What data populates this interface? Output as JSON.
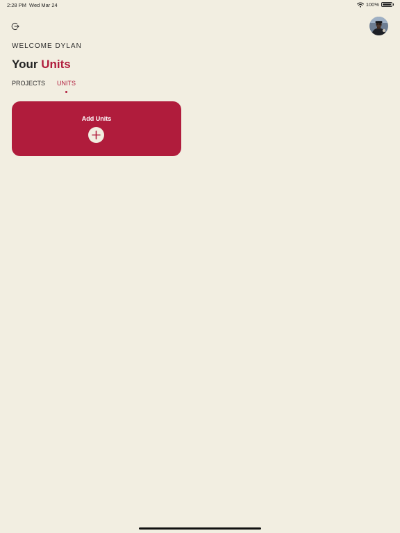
{
  "status_bar": {
    "time": "2:28 PM",
    "date": "Wed Mar 24",
    "battery_text": "100%",
    "battery_level": 1.0,
    "icons": [
      "wifi-icon",
      "battery-icon"
    ]
  },
  "header": {
    "logout_icon": "logout-icon",
    "avatar_icon": "user-avatar"
  },
  "welcome": "WELCOME DYLAN",
  "title": {
    "prefix": "Your",
    "accent": "Units"
  },
  "tabs": [
    {
      "label": "PROJECTS",
      "active": false
    },
    {
      "label": "UNITS",
      "active": true
    }
  ],
  "add_card": {
    "label": "Add Units",
    "icon": "plus-icon"
  },
  "colors": {
    "background": "#f2eee1",
    "accent": "#b01c3c",
    "text": "#222222"
  }
}
